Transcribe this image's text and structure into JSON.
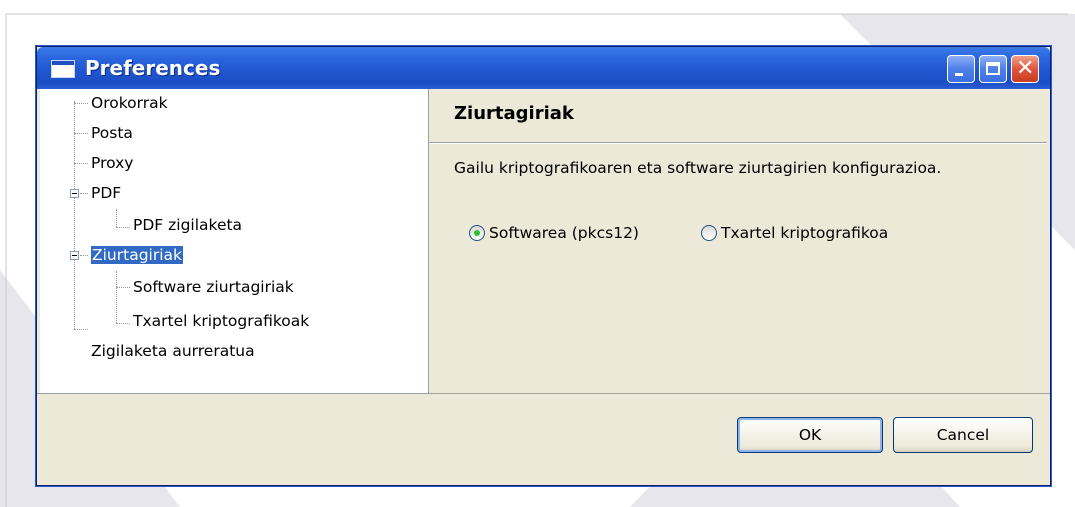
{
  "window": {
    "title": "Preferences"
  },
  "tree": {
    "items": [
      {
        "label": "Orokorrak",
        "level": 0
      },
      {
        "label": "Posta",
        "level": 0
      },
      {
        "label": "Proxy",
        "level": 0
      },
      {
        "label": "PDF",
        "level": 0,
        "expanded": true
      },
      {
        "label": "PDF zigilaketa",
        "level": 1
      },
      {
        "label": "Ziurtagiriak",
        "level": 0,
        "expanded": true,
        "selected": true
      },
      {
        "label": "Software ziurtagiriak",
        "level": 1
      },
      {
        "label": "Txartel kriptografikoak",
        "level": 1
      },
      {
        "label": "Zigilaketa aurreratua",
        "level": 0
      }
    ]
  },
  "content": {
    "title": "Ziurtagiriak",
    "description": "Gailu kriptografikoaren eta software ziurtagirien konfigurazioa.",
    "options": [
      {
        "label": "Softwarea (pkcs12)",
        "checked": true
      },
      {
        "label": "Txartel kriptografikoa",
        "checked": false
      }
    ]
  },
  "buttons": {
    "ok": "OK",
    "cancel": "Cancel"
  },
  "colors": {
    "titlebar": "#2b66df",
    "selection": "#316ac5",
    "dialog_bg": "#ece9d8"
  }
}
